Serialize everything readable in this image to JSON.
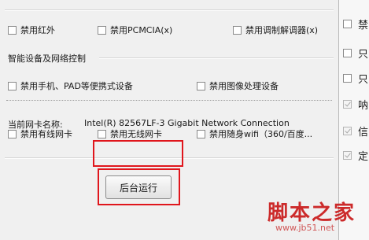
{
  "row1": {
    "infrared": "禁用红外",
    "pcmcia": "禁用PCMCIA(x)",
    "modem": "禁用调制解调器(x)"
  },
  "smart_section": {
    "title": "智能设备及网络控制",
    "portable": "禁用手机、PAD等便携式设备",
    "imaging": "禁用图像处理设备"
  },
  "network": {
    "nic_label": "当前网卡名称:",
    "nic_value": "Intel(R) 82567LF-3 Gigabit Network Connection",
    "wired": "禁用有线网卡",
    "wireless": "禁用无线网卡",
    "portable_wifi": "禁用随身wifi（360/百度..."
  },
  "run_button": "后台运行",
  "right_strip_glyphs": [
    "禁",
    "只",
    "只",
    "呐",
    "信",
    "定"
  ],
  "right_strip_checked": [
    false,
    false,
    false,
    true,
    true,
    true
  ],
  "watermark": {
    "main": "脚本之家",
    "url": "www.jb51.net"
  },
  "colors": {
    "highlight": "#e0161c",
    "watermark": "#cc2a2a"
  }
}
